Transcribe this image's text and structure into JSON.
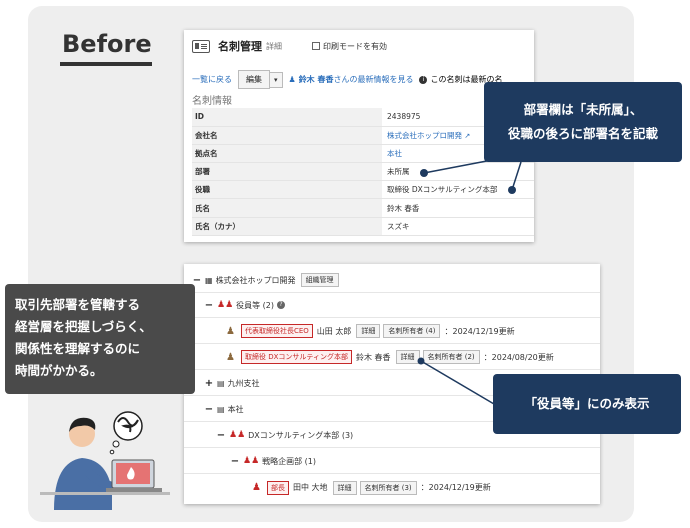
{
  "before_label": "Before",
  "top_card": {
    "title": "名刺管理",
    "title_sub": "詳細",
    "print_mode_label": "印刷モードを有効",
    "back_link": "一覧に戻る",
    "edit_button": "編集",
    "latest_link_name": "鈴木 春香",
    "latest_link_rest": "さんの最新情報を見る",
    "info_notice": "この名刺は最新の名",
    "section_title": "名刺情報",
    "rows": [
      {
        "key": "ID",
        "value": "2438975"
      },
      {
        "key": "会社名",
        "value": "株式会社ホップロ開発"
      },
      {
        "key": "拠点名",
        "value": "本社"
      },
      {
        "key": "部署",
        "value": "未所属"
      },
      {
        "key": "役職",
        "value": "取締役 DXコンサルティング本部"
      },
      {
        "key": "氏名",
        "value": "鈴木 春香"
      },
      {
        "key": "氏名（カナ）",
        "value": "スズキ"
      }
    ]
  },
  "callouts": {
    "c1_line1": "部署欄は「未所属」、",
    "c1_line2": "役職の後ろに部署名を記載",
    "c2": "「役員等」にのみ表示",
    "c3_lines": [
      "取引先部署を管轄する",
      "経営層を把握しづらく、",
      "関係性を理解するのに",
      "時間がかかる。"
    ]
  },
  "org_tree": {
    "company": "株式会社ホップロ開発",
    "org_manage_button": "組織管理",
    "officers_group": "役員等 (2)",
    "detail_button": "詳細",
    "rows": [
      {
        "role": "代表取締役社長CEO",
        "name": "山田 太郎",
        "owners": "名刺所有者 (4)",
        "date": "：2024/12/19更新"
      },
      {
        "role": "取締役 DXコンサルティング本部",
        "name": "鈴木 春香",
        "owners": "名刺所有者 (2)",
        "date": "：2024/08/20更新"
      }
    ],
    "branch_kyushu": "九州支社",
    "branch_honsha": "本社",
    "dept_dx": "DXコンサルティング本部 (3)",
    "dept_strategy": "戦略企画部 (1)",
    "manager": {
      "role": "部長",
      "name": "田中 大地",
      "owners": "名刺所有者 (3)",
      "date": "：2024/12/19更新"
    }
  },
  "colors": {
    "callout_navy": "#1e3a5f",
    "callout_gray": "#4a4a4a",
    "accent_red": "#c62828",
    "link_blue": "#2a6ebb"
  }
}
